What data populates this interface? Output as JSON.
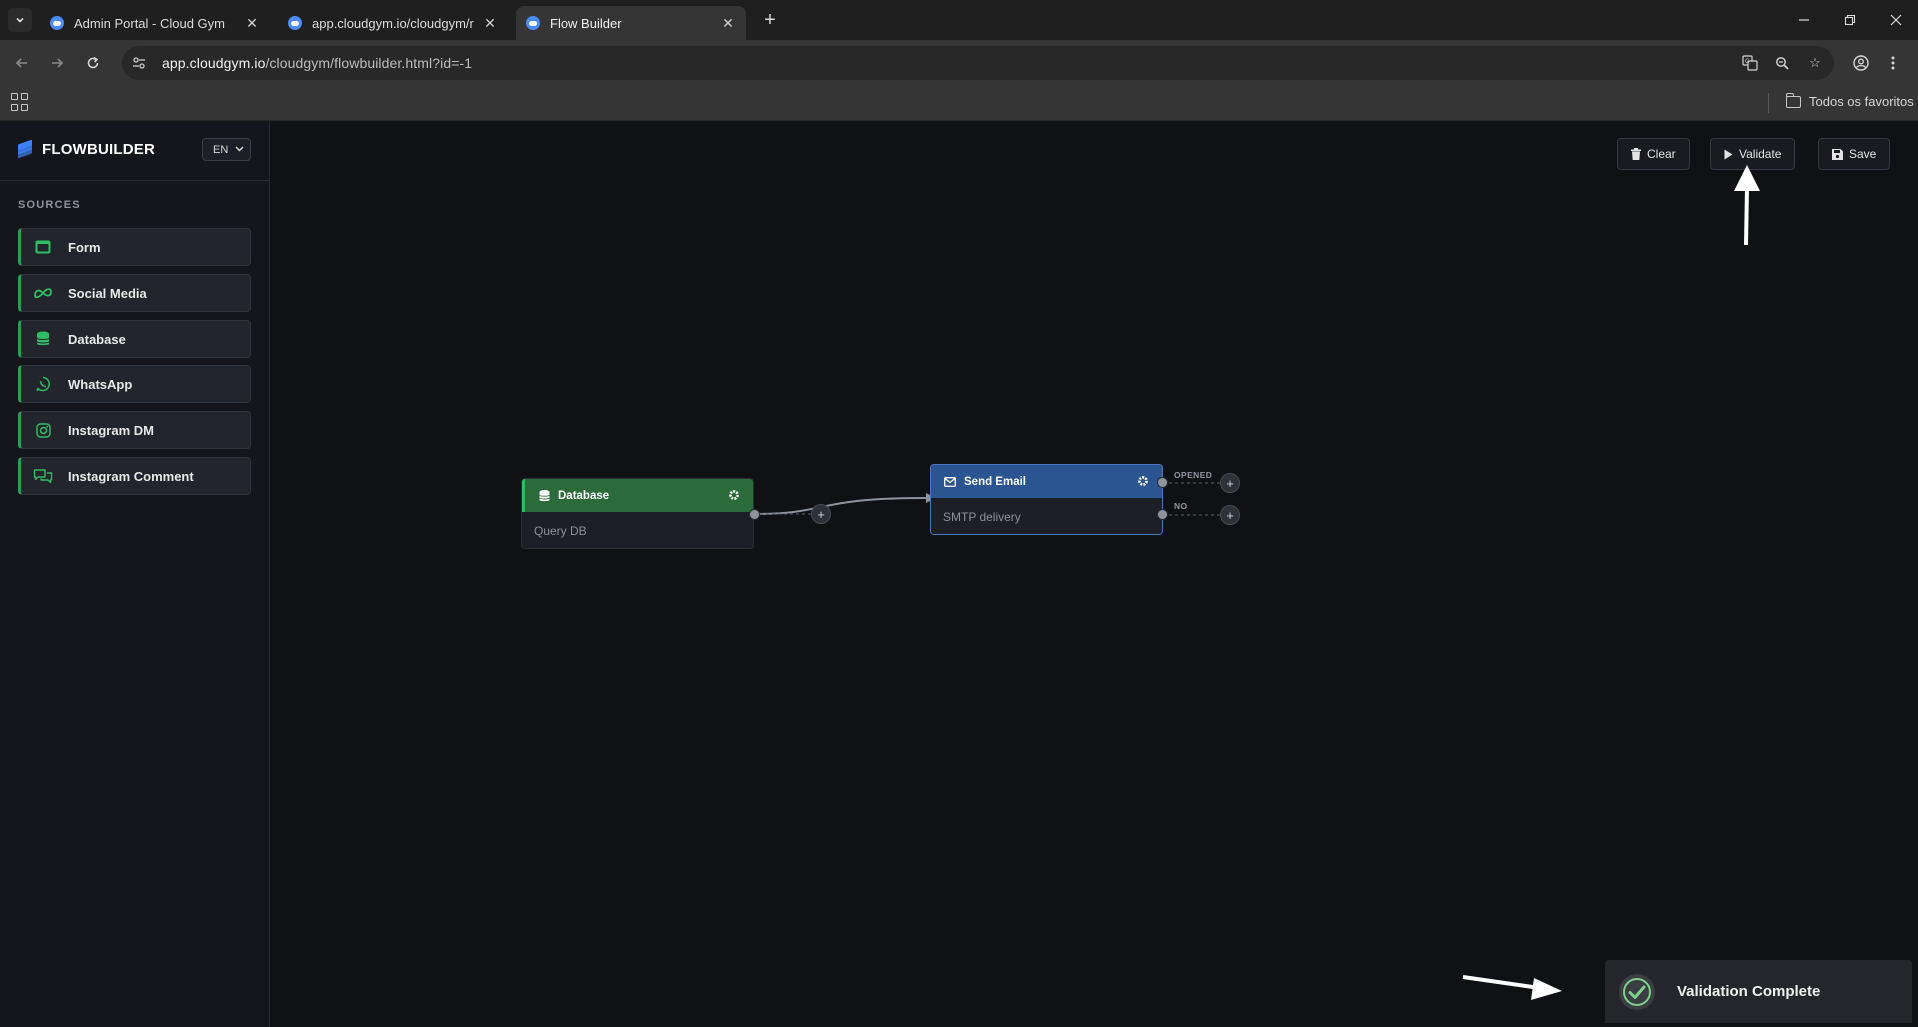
{
  "browser": {
    "tabs": [
      {
        "title": "Admin Portal - Cloud Gym",
        "active": false
      },
      {
        "title": "app.cloudgym.io/cloudgym/rep",
        "active": false
      },
      {
        "title": "Flow Builder",
        "active": true
      }
    ],
    "url_host": "app.cloudgym.io",
    "url_path": "/cloudgym/flowbuilder.html?id=-1",
    "bookmarks_folder": "Todos os favoritos"
  },
  "sidebar": {
    "brand": "FLOWBUILDER",
    "language": "EN",
    "section_label": "SOURCES",
    "items": [
      {
        "label": "Form",
        "icon": "form-icon"
      },
      {
        "label": "Social Media",
        "icon": "meta-icon"
      },
      {
        "label": "Database",
        "icon": "database-icon"
      },
      {
        "label": "WhatsApp",
        "icon": "whatsapp-icon"
      },
      {
        "label": "Instagram DM",
        "icon": "instagram-icon"
      },
      {
        "label": "Instagram Comment",
        "icon": "comment-icon"
      }
    ]
  },
  "toolbar": {
    "clear_label": "Clear",
    "validate_label": "Validate",
    "save_label": "Save"
  },
  "nodes": {
    "database": {
      "title": "Database",
      "subtitle": "Query DB",
      "color": "#2b6b3a"
    },
    "email": {
      "title": "Send Email",
      "subtitle": "SMTP delivery",
      "color": "#2a5590",
      "outputs": [
        "OPENED",
        "NO"
      ]
    }
  },
  "toast": {
    "message": "Validation Complete"
  },
  "colors": {
    "accent_green": "#2fbd63",
    "accent_blue": "#3b82f6",
    "canvas_bg": "#0f1115"
  }
}
